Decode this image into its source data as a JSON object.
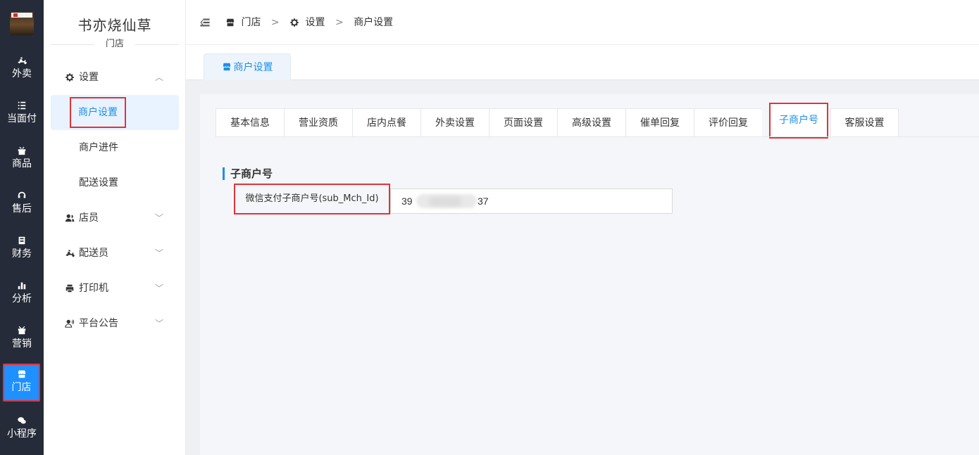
{
  "rail": {
    "items": [
      {
        "label": "外卖",
        "icon": "delivery-scooter-icon"
      },
      {
        "label": "当面付",
        "icon": "list-icon"
      },
      {
        "label": "商品",
        "icon": "gift-icon"
      },
      {
        "label": "售后",
        "icon": "headset-icon"
      },
      {
        "label": "财务",
        "icon": "ledger-icon"
      },
      {
        "label": "分析",
        "icon": "bar-chart-icon"
      },
      {
        "label": "营销",
        "icon": "gift-box-icon"
      },
      {
        "label": "门店",
        "icon": "store-icon"
      },
      {
        "label": "小程序",
        "icon": "wechat-icon"
      }
    ],
    "active_index": 7
  },
  "sidebar": {
    "brand": "书亦烧仙草",
    "brand_sub": "门店",
    "settings": {
      "label": "设置",
      "arrow": "^"
    },
    "sub_items": [
      "商户设置",
      "商户进件",
      "配送设置"
    ],
    "groups": [
      {
        "label": "店员",
        "arrow": "v"
      },
      {
        "label": "配送员",
        "arrow": "v"
      },
      {
        "label": "打印机",
        "arrow": "v"
      },
      {
        "label": "平台公告",
        "arrow": "v"
      }
    ]
  },
  "breadcrumb": {
    "items": [
      "门店",
      "设置",
      "商户设置"
    ],
    "separator": ">"
  },
  "page_tab": {
    "label": "商户设置"
  },
  "tabs": {
    "items": [
      "基本信息",
      "营业资质",
      "店内点餐",
      "外卖设置",
      "页面设置",
      "高级设置",
      "催单回复",
      "评价回复",
      "子商户号",
      "客服设置"
    ],
    "active_index": 8
  },
  "section": {
    "title": "子商户号"
  },
  "field": {
    "label": "微信支付子商户号(sub_Mch_Id)",
    "value_prefix": "39",
    "value_suffix": "37"
  },
  "colors": {
    "accent": "#1e8fe8",
    "rail_bg": "#252b38",
    "highlight": "#e0333a"
  }
}
